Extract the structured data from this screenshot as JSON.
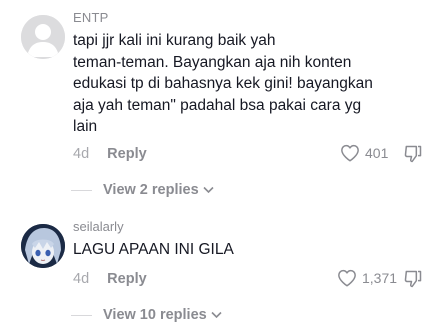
{
  "comments": [
    {
      "username": "ENTP",
      "text_lines": [
        "tapi jjr kali ini kurang baik yah",
        "teman-teman. Bayangkan aja nih konten",
        "edukasi tp di bahasnya kek gini! bayangkan",
        "aja yah teman\" padahal bsa pakai cara yg",
        "lain"
      ],
      "date": "4d",
      "reply_label": "Reply",
      "likes": "401",
      "view_replies": "View 2 replies",
      "avatar_icon": "default-avatar-icon"
    },
    {
      "username": "seilalarly",
      "text_lines": [
        "LAGU APAAN INI GILA"
      ],
      "date": "4d",
      "reply_label": "Reply",
      "likes": "1,371",
      "view_replies": "View 10 replies",
      "avatar_icon": "anime-avatar-icon"
    }
  ],
  "colors": {
    "text": "#161823",
    "secondary": "#8a8b91",
    "muted": "#a7a8ad",
    "avatar_placeholder": "#dcdcde"
  }
}
